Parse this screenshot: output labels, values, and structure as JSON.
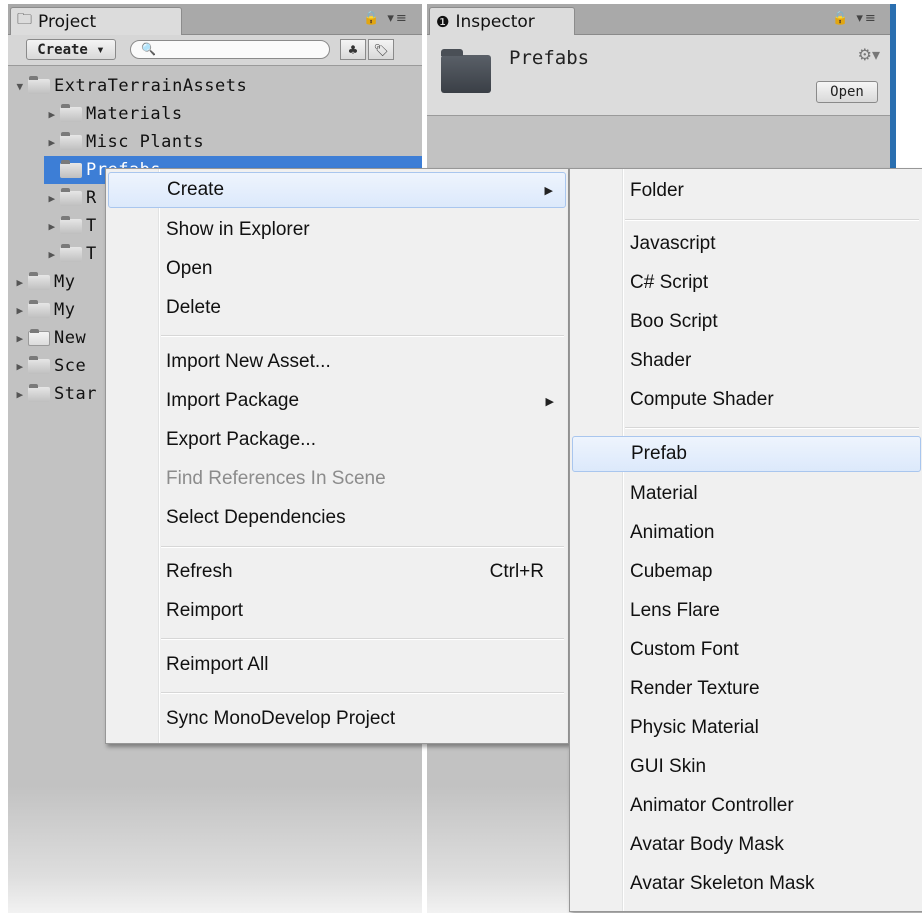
{
  "project_panel": {
    "tab_label": "Project",
    "lock_controls": "🔒 ▾≡",
    "toolbar": {
      "create_label": "Create ▾",
      "search_placeholder": "🔍"
    },
    "tree": [
      {
        "label": "ExtraTerrainAssets",
        "expanded": true
      },
      {
        "label": "Materials"
      },
      {
        "label": "Misc Plants"
      },
      {
        "label": "Prefabs",
        "selected": true
      },
      {
        "label": "R"
      },
      {
        "label": "T"
      },
      {
        "label": "T"
      },
      {
        "label": "My"
      },
      {
        "label": "My"
      },
      {
        "label": "New"
      },
      {
        "label": "Sce"
      },
      {
        "label": "Star"
      }
    ]
  },
  "inspector_panel": {
    "tab_label": "Inspector",
    "lock_controls": "🔒 ▾≡",
    "title": "Prefabs",
    "open_button": "Open"
  },
  "context_menu": {
    "items": [
      {
        "label": "Create",
        "submenu": true,
        "highlighted": true
      },
      {
        "label": "Show in Explorer"
      },
      {
        "label": "Open"
      },
      {
        "label": "Delete"
      },
      {
        "label": "Import New Asset..."
      },
      {
        "label": "Import Package",
        "submenu": true
      },
      {
        "label": "Export Package..."
      },
      {
        "label": "Find References In Scene",
        "disabled": true
      },
      {
        "label": "Select Dependencies"
      },
      {
        "label": "Refresh",
        "shortcut": "Ctrl+R"
      },
      {
        "label": "Reimport"
      },
      {
        "label": "Reimport All"
      },
      {
        "label": "Sync MonoDevelop Project"
      }
    ]
  },
  "create_submenu": {
    "items": [
      {
        "label": "Folder"
      },
      {
        "label": "Javascript"
      },
      {
        "label": "C# Script"
      },
      {
        "label": "Boo Script"
      },
      {
        "label": "Shader"
      },
      {
        "label": "Compute Shader"
      },
      {
        "label": "Prefab",
        "highlighted": true
      },
      {
        "label": "Material"
      },
      {
        "label": "Animation"
      },
      {
        "label": "Cubemap"
      },
      {
        "label": "Lens Flare"
      },
      {
        "label": "Custom Font"
      },
      {
        "label": "Render Texture"
      },
      {
        "label": "Physic Material"
      },
      {
        "label": "GUI Skin"
      },
      {
        "label": "Animator Controller"
      },
      {
        "label": "Avatar Body Mask"
      },
      {
        "label": "Avatar Skeleton Mask"
      }
    ]
  },
  "colors": {
    "selection": "#3d7ed6",
    "panel_bg": "#c2c2c2",
    "menu_bg": "#f0f0f0",
    "highlight_border": "#a9c6ee"
  }
}
